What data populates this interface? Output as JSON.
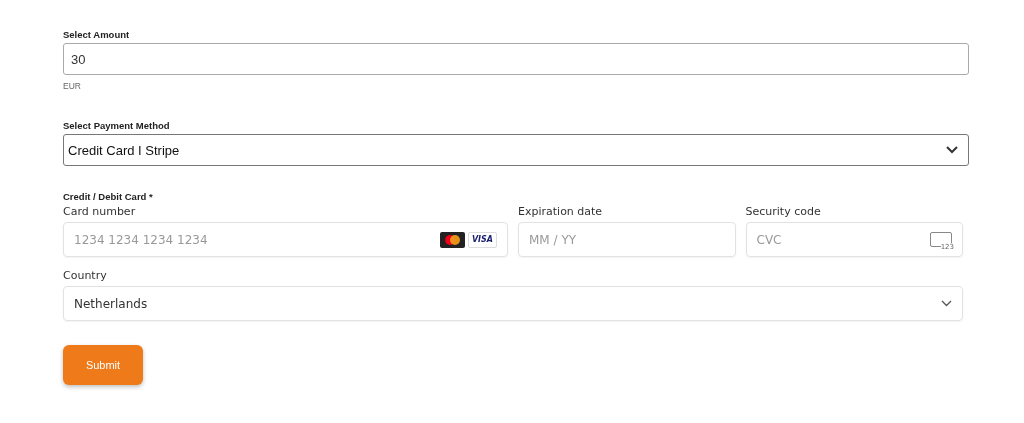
{
  "amount": {
    "label": "Select Amount",
    "value": "30",
    "currency": "EUR"
  },
  "payment_method": {
    "label": "Select Payment Method",
    "value": "Credit Card I Stripe"
  },
  "card": {
    "label": "Credit / Debit Card *",
    "fields": [
      {
        "kind": "number",
        "label": "Card number",
        "placeholder": "1234 1234 1234 1234",
        "brand_text": "VISA"
      },
      {
        "kind": "expiry",
        "label": "Expiration date",
        "placeholder": "MM / YY"
      },
      {
        "kind": "cvc",
        "label": "Security code",
        "placeholder": "CVC",
        "icon_text": "123"
      }
    ],
    "country": {
      "label": "Country",
      "value": "Netherlands"
    }
  },
  "submit": "Submit"
}
